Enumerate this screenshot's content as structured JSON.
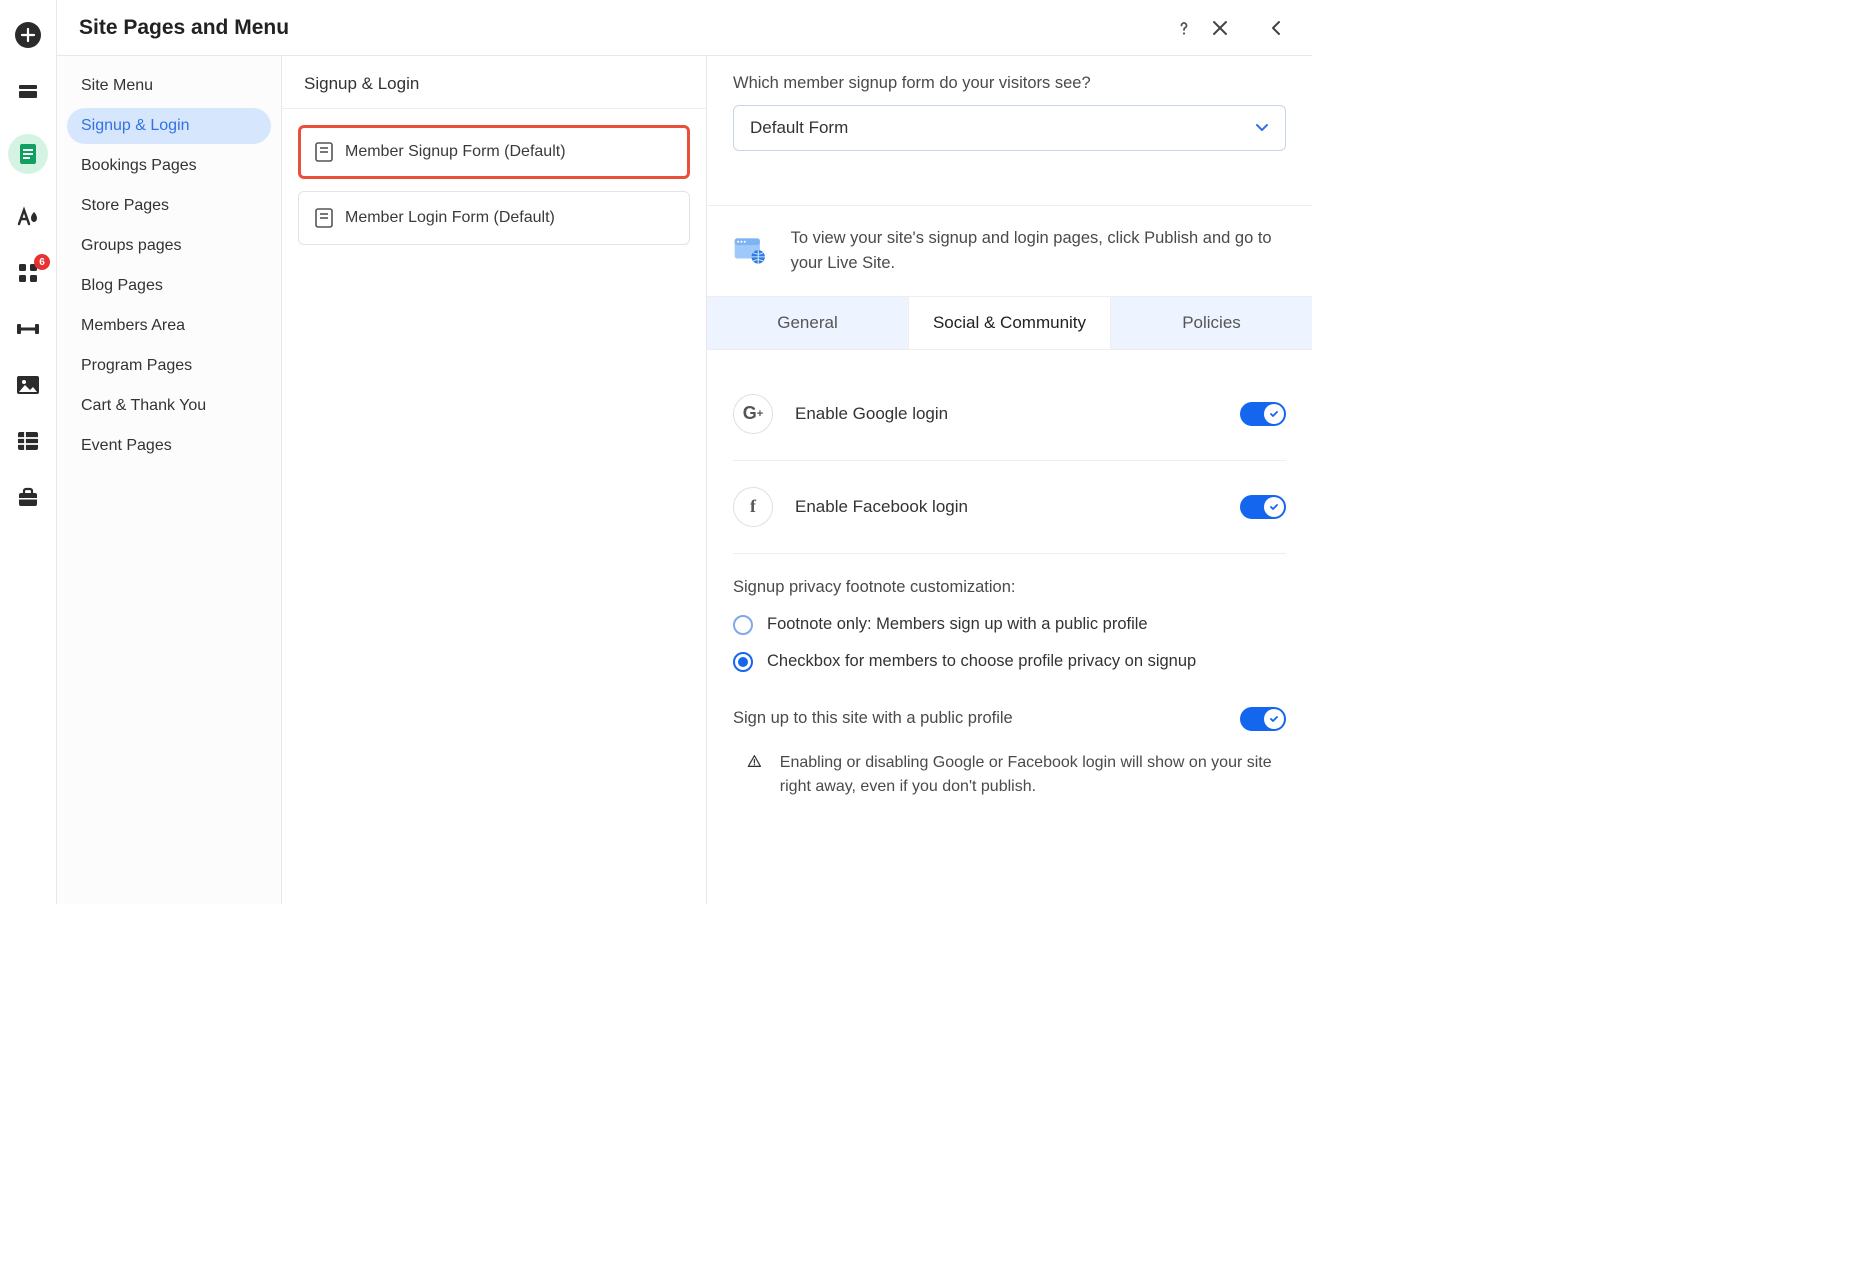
{
  "rail": {
    "badge": "6"
  },
  "header": {
    "title": "Site Pages and Menu"
  },
  "panel1": {
    "items": [
      "Site Menu",
      "Signup & Login",
      "Bookings Pages",
      "Store Pages",
      "Groups pages",
      "Blog Pages",
      "Members Area",
      "Program Pages",
      "Cart & Thank You",
      "Event Pages"
    ]
  },
  "panel2": {
    "section_title": "Signup & Login",
    "pages": [
      "Member Signup Form (Default)",
      "Member Login Form (Default)"
    ]
  },
  "panel3": {
    "title": "Member Signup Form (Default)",
    "question": "Which member signup form do your visitors see?",
    "select_value": "Default Form",
    "info_text": "To view your site's signup and login pages, click Publish and go to your Live Site.",
    "tabs": [
      "General",
      "Social & Community",
      "Policies"
    ],
    "active_tab": 1,
    "google_label": "Enable Google login",
    "facebook_label": "Enable Facebook login",
    "privacy_subhead": "Signup privacy footnote customization:",
    "radio_options": [
      "Footnote only: Members sign up with a public profile",
      "Checkbox for members to choose profile privacy on signup"
    ],
    "radio_selected": 1,
    "public_label": "Sign up to this site with a public profile",
    "warning_text": "Enabling or disabling Google or Facebook login will show on your site right away, even if you don't publish."
  }
}
